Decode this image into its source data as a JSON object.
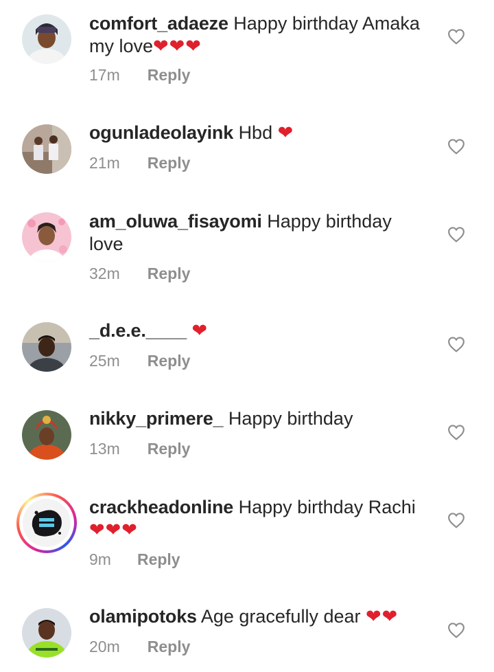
{
  "reply_label": "Reply",
  "heart_glyph": "❤",
  "comments": [
    {
      "username": "comfort_adaeze",
      "text_line1": "Happy birthday Amaka",
      "text_line2": "my love",
      "hearts": "❤❤❤",
      "time": "17m",
      "avatar_icon": "profile-photo-woman-headwrap"
    },
    {
      "username": "ogunladeolayink",
      "text_line1": "Hbd ",
      "hearts": "❤",
      "time": "21m",
      "avatar_icon": "profile-photo-two-people"
    },
    {
      "username": "am_oluwa_fisayomi",
      "text_line1": "Happy birthday",
      "text_line2": "love",
      "time": "32m",
      "avatar_icon": "profile-photo-woman-pink"
    },
    {
      "username": "_d.e.e.____",
      "text_line1": " ",
      "hearts": "❤",
      "time": "25m",
      "avatar_icon": "profile-photo-man"
    },
    {
      "username": "nikky_primere_",
      "text_line1": "Happy birthday",
      "time": "13m",
      "avatar_icon": "profile-photo-woman-gele"
    },
    {
      "username": "crackheadonline",
      "text_line1": "Happy birthday Rachi",
      "hearts2": "❤❤❤",
      "time": "9m",
      "avatar_icon": "crackheads-logo"
    },
    {
      "username": "olamipotoks",
      "text_line1": "Age gracefully dear ",
      "hearts": "❤❤",
      "time": "20m",
      "avatar_icon": "profile-photo-man-green-shirt"
    }
  ],
  "colors": {
    "text": "#262626",
    "meta": "#8e8e8e",
    "heart": "#e0202c"
  }
}
